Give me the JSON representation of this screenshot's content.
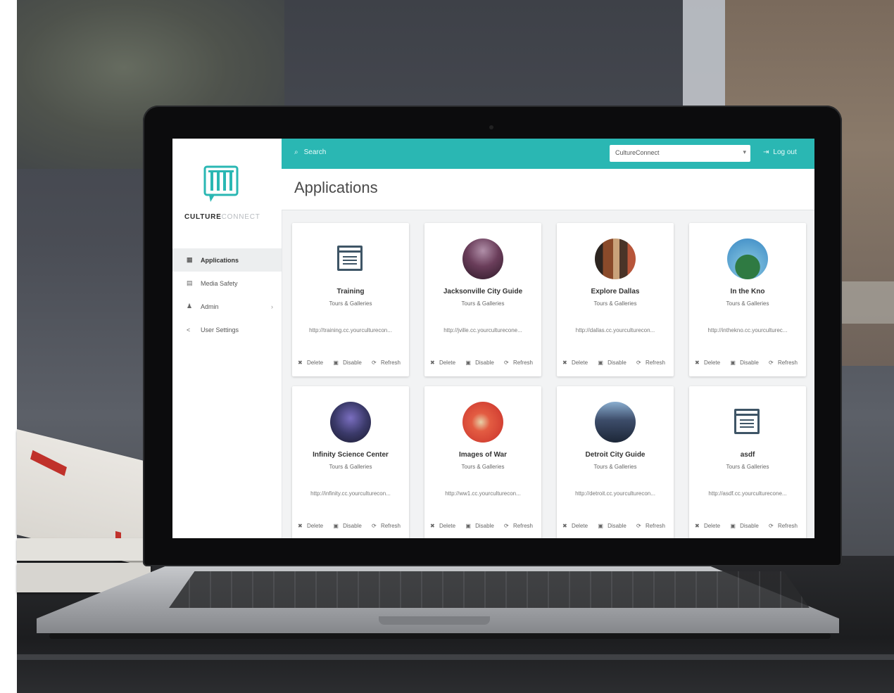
{
  "app": {
    "logo_text_bold": "CULTURE",
    "logo_text_light": "CONNECT"
  },
  "sidebar": {
    "items": [
      {
        "label": "Applications",
        "icon": "grid-icon",
        "active": true
      },
      {
        "label": "Media Safety",
        "icon": "image-icon",
        "active": false
      },
      {
        "label": "Admin",
        "icon": "user-icon",
        "active": false,
        "has_children": true
      },
      {
        "label": "User Settings",
        "icon": "share-icon",
        "active": false
      }
    ]
  },
  "topbar": {
    "search_placeholder": "Search",
    "org_select_value": "CultureConnect",
    "logout_label": "Log out",
    "accent_color": "#2ab7b3"
  },
  "page": {
    "title": "Applications"
  },
  "actions": {
    "delete": "Delete",
    "disable": "Disable",
    "refresh": "Refresh"
  },
  "cards": [
    {
      "title": "Training",
      "subtitle": "Tours & Galleries",
      "url": "http://training.cc.yourculturecon...",
      "icon": "document-icon"
    },
    {
      "title": "Jacksonville City Guide",
      "subtitle": "Tours & Galleries",
      "url": "http://jville.cc.yourculturecone...",
      "icon": "photo-thumbnail"
    },
    {
      "title": "Explore Dallas",
      "subtitle": "Tours & Galleries",
      "url": "http://dallas.cc.yourculturecon...",
      "icon": "photo-thumbnail"
    },
    {
      "title": "In the Kno",
      "subtitle": "Tours & Galleries",
      "url": "http://inthekno.cc.yourculturec...",
      "icon": "photo-thumbnail"
    },
    {
      "title": "Infinity Science Center",
      "subtitle": "Tours & Galleries",
      "url": "http://infinity.cc.yourculturecon...",
      "icon": "photo-thumbnail"
    },
    {
      "title": "Images of War",
      "subtitle": "Tours & Galleries",
      "url": "http://ww1.cc.yourculturecon...",
      "icon": "photo-thumbnail"
    },
    {
      "title": "Detroit City Guide",
      "subtitle": "Tours & Galleries",
      "url": "http://detroit.cc.yourculturecon...",
      "icon": "photo-thumbnail"
    },
    {
      "title": "asdf",
      "subtitle": "Tours & Galleries",
      "url": "http://asdf.cc.yourculturecone...",
      "icon": "document-icon"
    }
  ]
}
